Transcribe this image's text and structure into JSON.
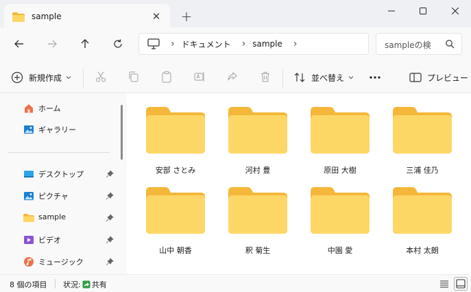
{
  "tab": {
    "title": "sample",
    "close_glyph": "✕",
    "new_tab_glyph": "+"
  },
  "window": {
    "minimize_icon": "minimize-icon",
    "maximize_icon": "maximize-icon",
    "close_icon": "close-icon"
  },
  "address": {
    "crumbs": [
      "ドキュメント",
      "sample"
    ],
    "search_placeholder": "sampleの検"
  },
  "command_bar": {
    "new_label": "新規作成",
    "sort_label": "並べ替え",
    "preview_label": "プレビュー"
  },
  "sidebar": {
    "top_items": [
      {
        "label": "ホーム",
        "icon": "home-icon"
      },
      {
        "label": "ギャラリー",
        "icon": "gallery-icon"
      }
    ],
    "pinned_items": [
      {
        "label": "デスクトップ",
        "icon": "desktop-icon"
      },
      {
        "label": "ピクチャ",
        "icon": "pictures-icon"
      },
      {
        "label": "sample",
        "icon": "folder-icon"
      },
      {
        "label": "ビデオ",
        "icon": "videos-icon"
      },
      {
        "label": "ミュージック",
        "icon": "music-icon"
      }
    ]
  },
  "folders": [
    "安部 さとみ",
    "河村 豊",
    "原田 大樹",
    "三浦 佳乃",
    "山中 朝香",
    "釈 菊生",
    "中園 愛",
    "本村 太朗"
  ],
  "status": {
    "item_count": "8 個の項目",
    "status_label": "状況:",
    "share_label": "共有"
  },
  "colors": {
    "folder_back": "#f4b73a",
    "folder_front": "#fdd766",
    "accent": "#0067c0"
  }
}
